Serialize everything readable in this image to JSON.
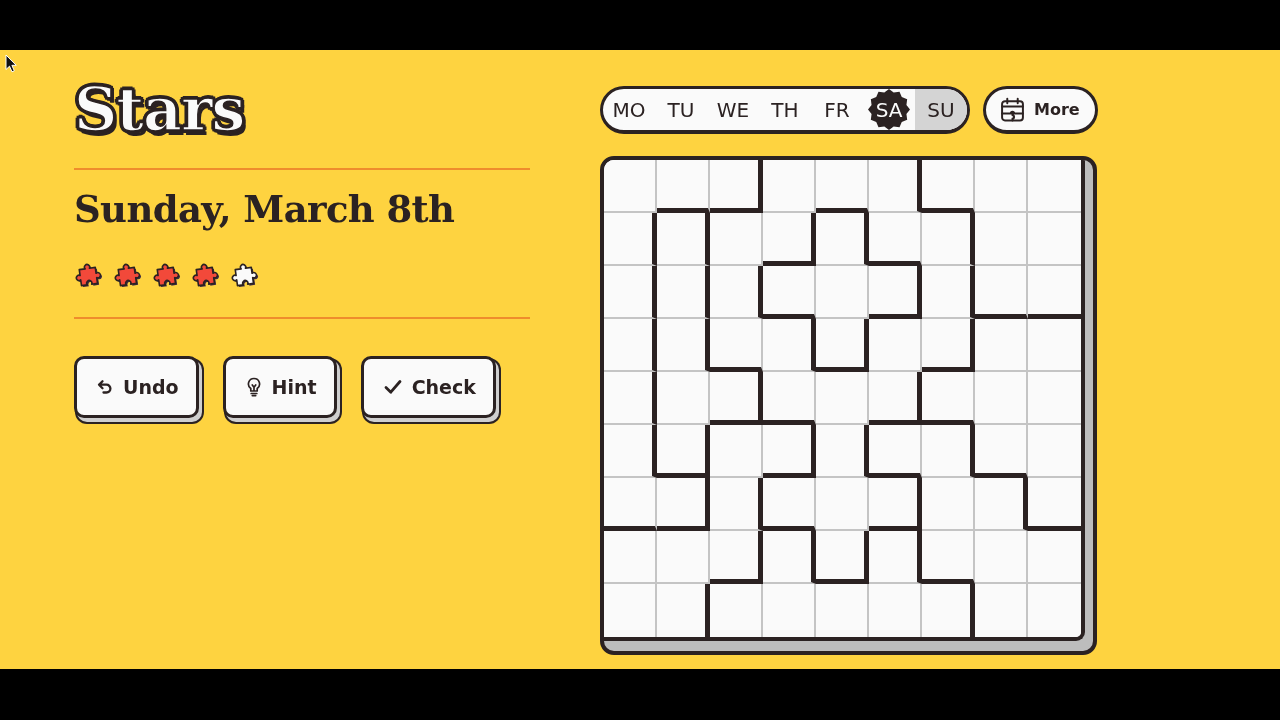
{
  "header": {
    "title": "Stars",
    "date": "Sunday, March 8th"
  },
  "difficulty": {
    "stars": 4
  },
  "actions": [
    {
      "kind": "undo",
      "label": "Undo"
    },
    {
      "kind": "hint",
      "label": "Hint"
    },
    {
      "kind": "check",
      "label": "Check"
    }
  ],
  "day_tabs": [
    {
      "label": "MO",
      "selected": false,
      "completed": false
    },
    {
      "label": "TU",
      "selected": false,
      "completed": false
    },
    {
      "label": "WE",
      "selected": false,
      "completed": false
    },
    {
      "label": "TH",
      "selected": false,
      "completed": false
    },
    {
      "label": "FR",
      "selected": false,
      "completed": false
    },
    {
      "label": "SA",
      "selected": false,
      "completed": true
    },
    {
      "label": "SU",
      "selected": true,
      "completed": false
    }
  ],
  "more_button": {
    "label": "More"
  },
  "grid": {
    "rows": [
      {
        "cells": [
          {
            "wall_right": false,
            "wall_below": false
          },
          {
            "wall_right": false,
            "wall_below": true
          },
          {
            "wall_right": true,
            "wall_below": true
          },
          {
            "wall_right": false,
            "wall_below": false
          },
          {
            "wall_right": false,
            "wall_below": true
          },
          {
            "wall_right": true,
            "wall_below": false
          },
          {
            "wall_right": false,
            "wall_below": true
          },
          {
            "wall_right": false,
            "wall_below": false
          },
          {
            "wall_right": false,
            "wall_below": false
          }
        ]
      },
      {
        "cells": [
          {
            "wall_right": true,
            "wall_below": false
          },
          {
            "wall_right": true,
            "wall_below": false
          },
          {
            "wall_right": false,
            "wall_below": false
          },
          {
            "wall_right": true,
            "wall_below": true
          },
          {
            "wall_right": true,
            "wall_below": false
          },
          {
            "wall_right": false,
            "wall_below": true
          },
          {
            "wall_right": true,
            "wall_below": false
          },
          {
            "wall_right": false,
            "wall_below": false
          },
          {
            "wall_right": false,
            "wall_below": false
          }
        ]
      },
      {
        "cells": [
          {
            "wall_right": true,
            "wall_below": false
          },
          {
            "wall_right": true,
            "wall_below": false
          },
          {
            "wall_right": true,
            "wall_below": false
          },
          {
            "wall_right": false,
            "wall_below": true
          },
          {
            "wall_right": false,
            "wall_below": false
          },
          {
            "wall_right": true,
            "wall_below": true
          },
          {
            "wall_right": true,
            "wall_below": false
          },
          {
            "wall_right": false,
            "wall_below": true
          },
          {
            "wall_right": false,
            "wall_below": true
          }
        ]
      },
      {
        "cells": [
          {
            "wall_right": true,
            "wall_below": false
          },
          {
            "wall_right": true,
            "wall_below": false
          },
          {
            "wall_right": false,
            "wall_below": true
          },
          {
            "wall_right": true,
            "wall_below": false
          },
          {
            "wall_right": true,
            "wall_below": true
          },
          {
            "wall_right": false,
            "wall_below": false
          },
          {
            "wall_right": true,
            "wall_below": true
          },
          {
            "wall_right": false,
            "wall_below": false
          },
          {
            "wall_right": false,
            "wall_below": false
          }
        ]
      },
      {
        "cells": [
          {
            "wall_right": true,
            "wall_below": false
          },
          {
            "wall_right": false,
            "wall_below": false
          },
          {
            "wall_right": true,
            "wall_below": true
          },
          {
            "wall_right": false,
            "wall_below": true
          },
          {
            "wall_right": false,
            "wall_below": false
          },
          {
            "wall_right": true,
            "wall_below": true
          },
          {
            "wall_right": false,
            "wall_below": true
          },
          {
            "wall_right": false,
            "wall_below": false
          },
          {
            "wall_right": false,
            "wall_below": false
          }
        ]
      },
      {
        "cells": [
          {
            "wall_right": true,
            "wall_below": false
          },
          {
            "wall_right": true,
            "wall_below": true
          },
          {
            "wall_right": false,
            "wall_below": false
          },
          {
            "wall_right": true,
            "wall_below": true
          },
          {
            "wall_right": true,
            "wall_below": false
          },
          {
            "wall_right": false,
            "wall_below": true
          },
          {
            "wall_right": true,
            "wall_below": false
          },
          {
            "wall_right": false,
            "wall_below": true
          },
          {
            "wall_right": false,
            "wall_below": false
          }
        ]
      },
      {
        "cells": [
          {
            "wall_right": false,
            "wall_below": true
          },
          {
            "wall_right": true,
            "wall_below": true
          },
          {
            "wall_right": true,
            "wall_below": false
          },
          {
            "wall_right": false,
            "wall_below": true
          },
          {
            "wall_right": false,
            "wall_below": false
          },
          {
            "wall_right": true,
            "wall_below": true
          },
          {
            "wall_right": false,
            "wall_below": false
          },
          {
            "wall_right": true,
            "wall_below": false
          },
          {
            "wall_right": false,
            "wall_below": true
          }
        ]
      },
      {
        "cells": [
          {
            "wall_right": false,
            "wall_below": false
          },
          {
            "wall_right": false,
            "wall_below": false
          },
          {
            "wall_right": true,
            "wall_below": true
          },
          {
            "wall_right": true,
            "wall_below": false
          },
          {
            "wall_right": true,
            "wall_below": true
          },
          {
            "wall_right": true,
            "wall_below": false
          },
          {
            "wall_right": false,
            "wall_below": true
          },
          {
            "wall_right": false,
            "wall_below": false
          },
          {
            "wall_right": false,
            "wall_below": false
          }
        ]
      },
      {
        "cells": [
          {
            "wall_right": false,
            "wall_below": false
          },
          {
            "wall_right": true,
            "wall_below": false
          },
          {
            "wall_right": false,
            "wall_below": false
          },
          {
            "wall_right": false,
            "wall_below": false
          },
          {
            "wall_right": false,
            "wall_below": false
          },
          {
            "wall_right": false,
            "wall_below": false
          },
          {
            "wall_right": true,
            "wall_below": false
          },
          {
            "wall_right": false,
            "wall_below": false
          },
          {
            "wall_right": false,
            "wall_below": false
          }
        ]
      }
    ]
  }
}
